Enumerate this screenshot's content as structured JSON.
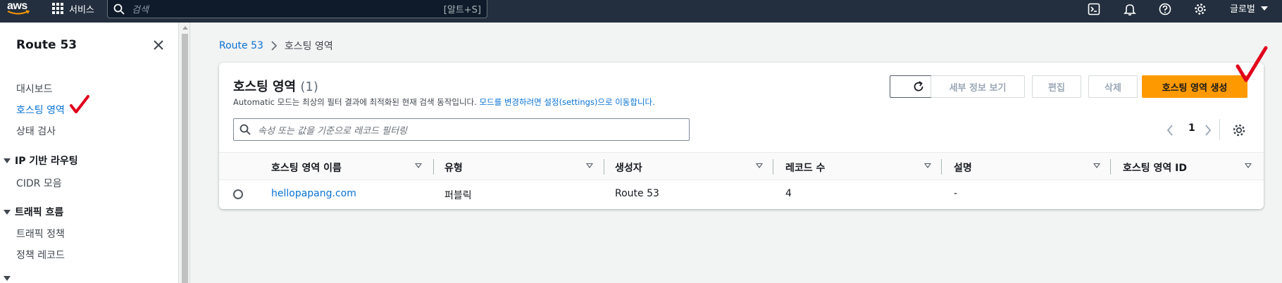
{
  "topnav": {
    "logo_text": "aws",
    "services_label": "서비스",
    "search_placeholder": "검색",
    "search_shortcut": "[알트+S]",
    "region_label": "글로벌"
  },
  "sidebar": {
    "title": "Route 53",
    "items": [
      {
        "label": "대시보드"
      },
      {
        "label": "호스팅 영역"
      },
      {
        "label": "상태 검사"
      }
    ],
    "sections": [
      {
        "label": "IP 기반 라우팅",
        "items": [
          "CIDR 모음"
        ]
      },
      {
        "label": "트래픽 흐름",
        "items": [
          "트래픽 정책",
          "정책 레코드"
        ]
      }
    ]
  },
  "breadcrumb": {
    "root": "Route 53",
    "current": "호스팅 영역"
  },
  "panel": {
    "title": "호스팅 영역",
    "count": "(1)",
    "description_prefix": "Automatic 모드는 최상의 필터 결과에 최적화된 현재 검색 동작입니다.",
    "description_link": "모드를 변경하려면 설정(settings)으로 이동합니다.",
    "buttons": {
      "details": "세부 정보 보기",
      "edit": "편집",
      "delete": "삭제",
      "create": "호스팅 영역 생성"
    },
    "filter_placeholder": "속성 또는 값을 기준으로 레코드 필터링",
    "page": "1"
  },
  "table": {
    "columns": [
      "호스팅 영역 이름",
      "유형",
      "생성자",
      "레코드 수",
      "설명",
      "호스팅 영역 ID"
    ],
    "rows": [
      {
        "name": "hellopapang.com",
        "type": "퍼블릭",
        "created_by": "Route 53",
        "record_count": "4",
        "description": "-",
        "id": ""
      }
    ]
  },
  "colors": {
    "nav_bg": "#232f3e",
    "link": "#0972d3",
    "primary": "#ff9900",
    "annotation": "#e0001b"
  }
}
